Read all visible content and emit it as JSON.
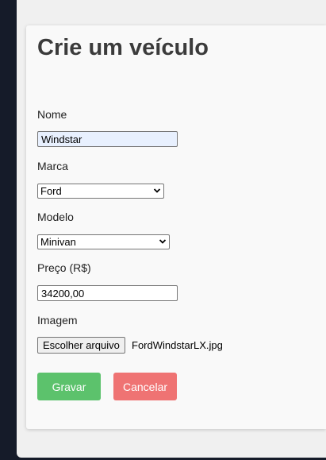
{
  "page": {
    "title": "Crie um veículo"
  },
  "form": {
    "name": {
      "label": "Nome",
      "value": "Windstar"
    },
    "brand": {
      "label": "Marca",
      "selected": "Ford"
    },
    "model": {
      "label": "Modelo",
      "selected": "Minivan"
    },
    "price": {
      "label": "Preço (R$)",
      "value": "34200,00"
    },
    "image": {
      "label": "Imagem",
      "button_label": "Escolher arquivo",
      "file_name": "FordWindstarLX.jpg"
    }
  },
  "actions": {
    "save_label": "Gravar",
    "cancel_label": "Cancelar"
  },
  "colors": {
    "save": "#5cc26c",
    "cancel": "#ef7373",
    "title": "#3b3b3b",
    "sidebar": "#151b29"
  },
  "icons": {
    "select_arrow": "chevron-down-icon"
  }
}
